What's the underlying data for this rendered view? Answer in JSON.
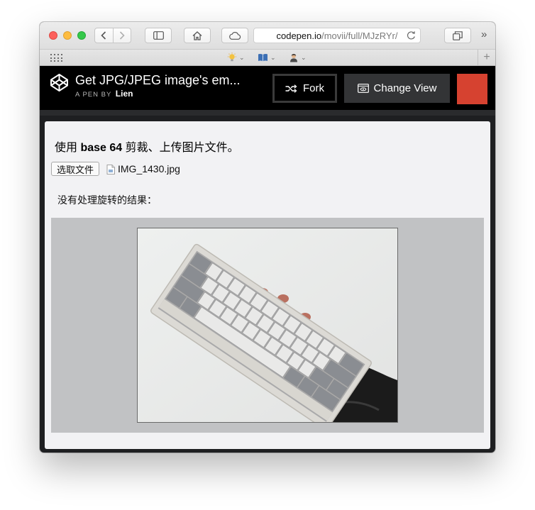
{
  "browser": {
    "url_host": "codepen.io",
    "url_path": "/movii/full/MJzRYr/",
    "nav_buttons": [
      "back",
      "forward"
    ],
    "toolbar_icons": [
      "sidebar-icon",
      "home-icon",
      "cloud-icon",
      "reload-icon",
      "tabs-overview-icon"
    ],
    "overflow_label": "»",
    "new_tab_label": "+",
    "favorites": [
      {
        "icon": "lightbulb-icon",
        "chevron": "⌄"
      },
      {
        "icon": "book-icon",
        "chevron": "⌄"
      },
      {
        "icon": "avatar-icon",
        "chevron": "⌄"
      }
    ],
    "colors": {
      "close": "#fc605c",
      "minimize": "#fdbc40",
      "maximize": "#34c84a"
    }
  },
  "codepen": {
    "title": "Get JPG/JPEG image's em...",
    "byline_prefix": "A PEN BY",
    "author": "Lien",
    "fork_label": "Fork",
    "change_view_label": "Change View",
    "accent_color": "#d64230"
  },
  "result": {
    "heading_pre": "使用 ",
    "heading_bold": "base 64",
    "heading_post": " 剪裁、上传图片文件。",
    "choose_file_label": "选取文件",
    "file_name": "IMG_1430.jpg",
    "note": "没有处理旋转的结果："
  }
}
